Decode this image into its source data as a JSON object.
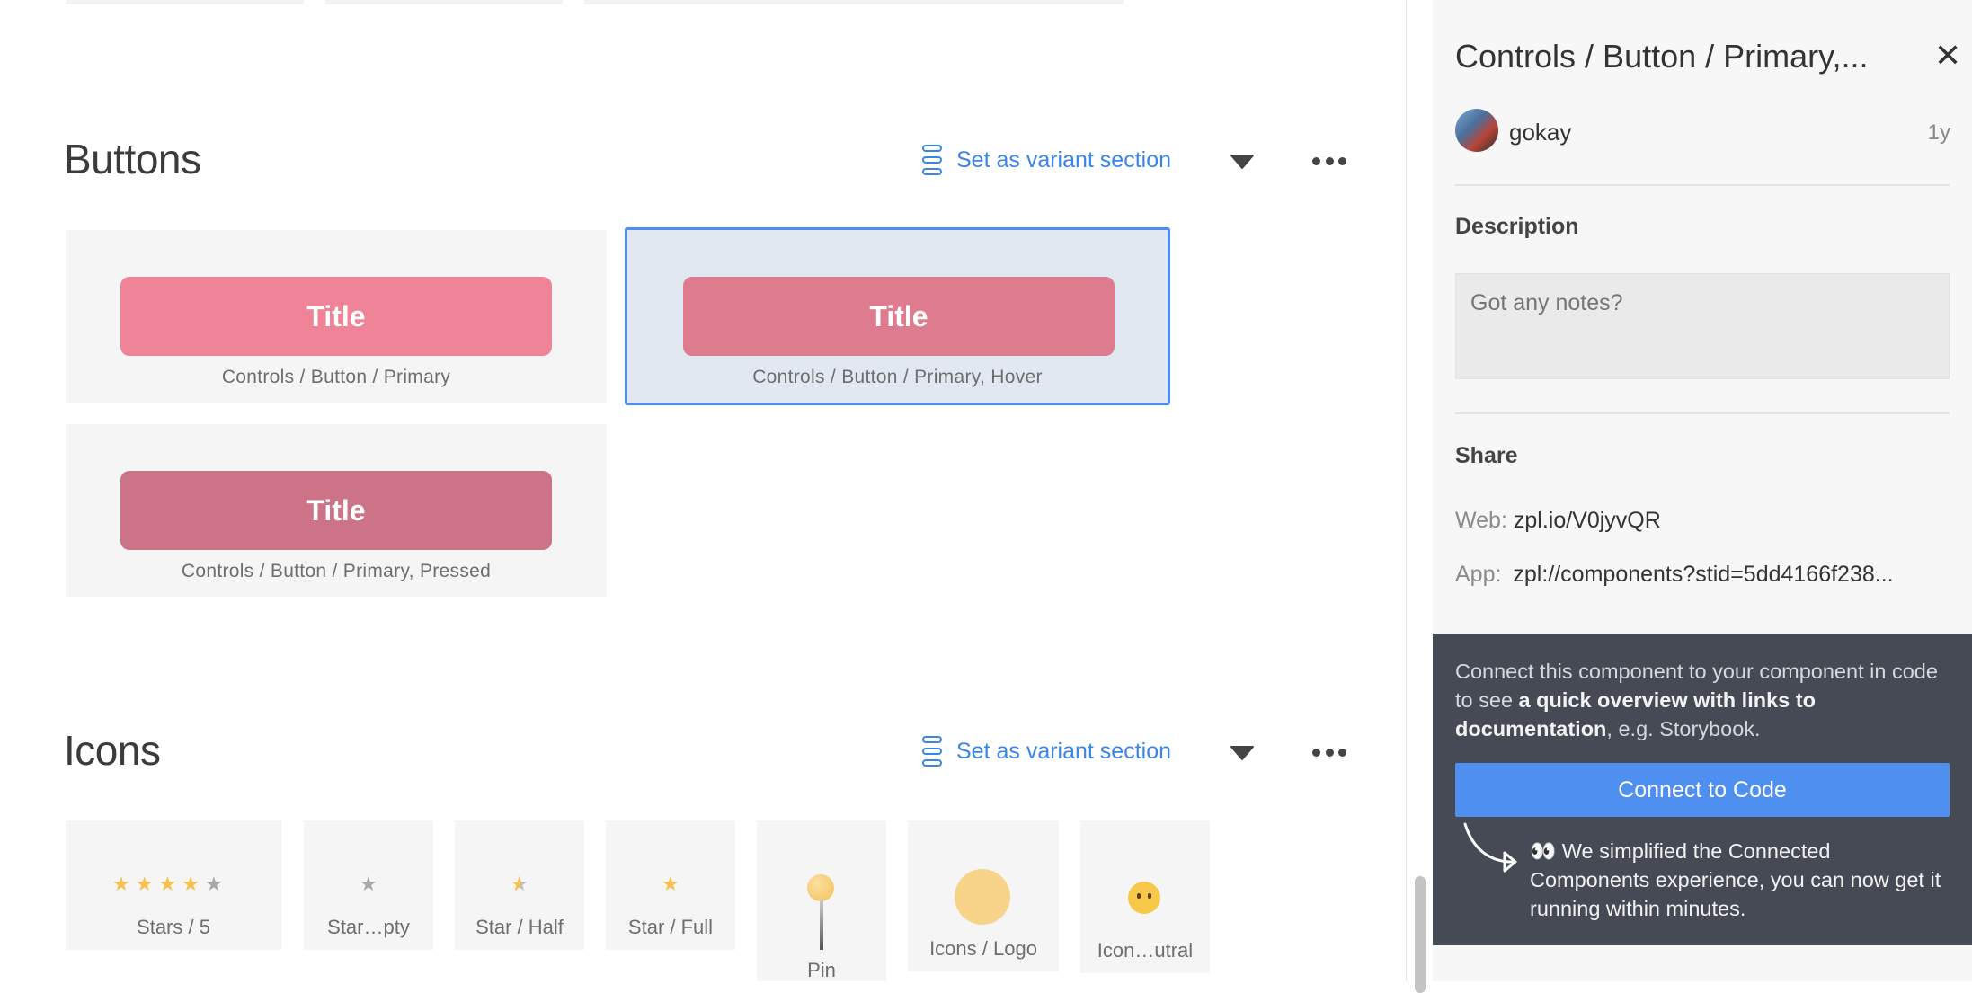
{
  "canvas": {
    "sections": [
      {
        "title": "Buttons",
        "variant_action": "Set as variant section",
        "cards": [
          {
            "button_text": "Title",
            "caption": "Controls / Button / Primary",
            "color": "#ef8499"
          },
          {
            "button_text": "Title",
            "caption": "Controls / Button / Primary, Hover",
            "color": "#df7b8f",
            "selected": true
          },
          {
            "button_text": "Title",
            "caption": "Controls / Button / Primary, Pressed",
            "color": "#cc7387"
          }
        ]
      },
      {
        "title": "Icons",
        "variant_action": "Set as variant section",
        "cards": [
          {
            "caption": "Stars / 5"
          },
          {
            "caption": "Star…pty"
          },
          {
            "caption": "Star / Half"
          },
          {
            "caption": "Star / Full"
          },
          {
            "caption": "Pin"
          },
          {
            "caption": "Icons / Logo"
          },
          {
            "caption": "Icon…utral"
          }
        ]
      }
    ]
  },
  "panel": {
    "title": "Controls / Button / Primary,...",
    "author": "gokay",
    "age": "1y",
    "description_label": "Description",
    "description_placeholder": "Got any notes?",
    "share_label": "Share",
    "web_key": "Web:",
    "web_value": "zpl.io/V0jyvQR",
    "app_key": "App:",
    "app_value": "zpl://components?stid=5dd4166f238...",
    "connect": {
      "text_1": "Connect this component to your component in code to see ",
      "text_bold_1": "a quick overview with links to documentation",
      "text_2": ", e.g. Storybook.",
      "button_label": "Connect to Code",
      "note_emoji": "👀",
      "note": "We simplified the Connected Components experience, you can now get it running within minutes."
    }
  },
  "colors": {
    "accent": "#4f8ff0",
    "link": "#3a86e8",
    "dark_panel": "#454a55"
  }
}
